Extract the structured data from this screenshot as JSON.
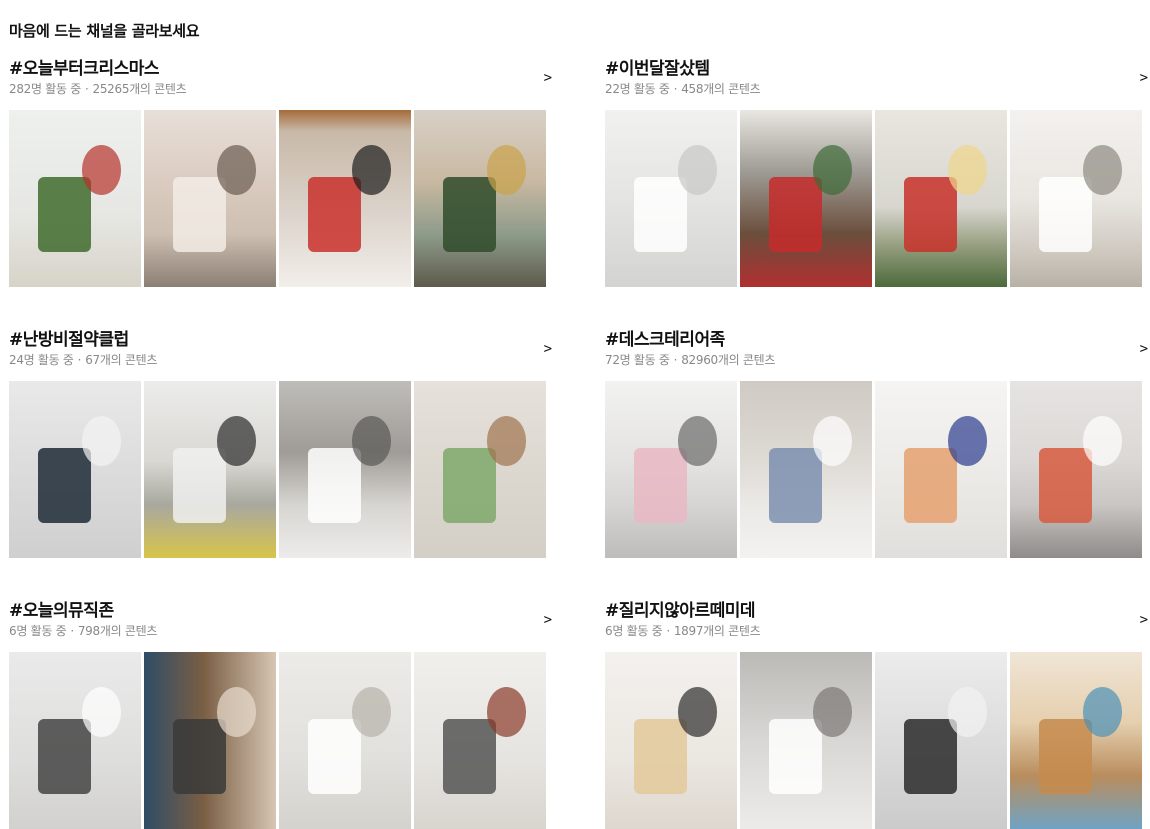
{
  "page": {
    "heading": "마음에 드는 채널을 골라보세요"
  },
  "channels": [
    {
      "name": "#오늘부터크리스마스",
      "members": "282명 활동 중",
      "sep": "·",
      "posts": "25265개의 콘텐츠",
      "more": ">",
      "thumbs": [
        {
          "bg": "linear-gradient(180deg,#eef0ee 0%,#e6e7e3 60%,#d7d3c8 100%)",
          "accent": "#3f6b2c",
          "accent2": "#b7322b"
        },
        {
          "bg": "linear-gradient(180deg,#e8dfd9 0%,#d9c9be 45%,#cdbfb1 70%,#8c7f74 100%)",
          "accent": "#f2ece5",
          "accent2": "#6b5b50"
        },
        {
          "bg": "linear-gradient(180deg,#a56b3a 0%,#c8b9a8 12%,#dcd4cc 60%,#f2eeea 100%)",
          "accent": "#c9302c",
          "accent2": "#1d1d1d"
        },
        {
          "bg": "linear-gradient(180deg,#d8d0c6 0%,#c9b9a2 40%,#8e9c8a 70%,#5e5a4c 100%)",
          "accent": "#2f4b2a",
          "accent2": "#c9a24a"
        }
      ]
    },
    {
      "name": "#이번달잘샀템",
      "members": "22명 활동 중",
      "sep": "·",
      "posts": "458개의 콘텐츠",
      "more": ">",
      "thumbs": [
        {
          "bg": "linear-gradient(180deg,#f1f1ef 0%,#e4e4e2 50%,#d3d3d1 100%)",
          "accent": "#ffffff",
          "accent2": "#c8c8c6"
        },
        {
          "bg": "linear-gradient(180deg,#e9e7e1 0%,#9e9b94 35%,#6b4e3c 70%,#b03030 100%)",
          "accent": "#c62b2b",
          "accent2": "#3d6b37"
        },
        {
          "bg": "linear-gradient(180deg,#e8e6df 0%,#d7d6cf 55%,#9ba285 75%,#4d6a3b 100%)",
          "accent": "#c8312a",
          "accent2": "#f0d58a"
        },
        {
          "bg": "linear-gradient(180deg,#f3f1ee 0%,#e9e6e1 50%,#cfc9c0 80%,#b8b1a6 100%)",
          "accent": "#ffffff",
          "accent2": "#8f8a82"
        }
      ]
    },
    {
      "name": "#난방비절약클럽",
      "members": "24명 활동 중",
      "sep": "·",
      "posts": "67개의 콘텐츠",
      "more": ">",
      "thumbs": [
        {
          "bg": "linear-gradient(180deg,#e9e9e9 0%,#dcdcdc 50%,#cfcfcf 100%)",
          "accent": "#1d2a36",
          "accent2": "#f4f4f4"
        },
        {
          "bg": "linear-gradient(180deg,#ececea 0%,#d9d8d3 45%,#a9a89f 70%,#d8c44a 100%)",
          "accent": "#f0f0ee",
          "accent2": "#2b2b2b"
        },
        {
          "bg": "linear-gradient(180deg,#bfbdb9 0%,#9f9c97 40%,#d7d5d1 70%,#eeecea 100%)",
          "accent": "#ffffff",
          "accent2": "#5a5855"
        },
        {
          "bg": "linear-gradient(180deg,#e6e2db 0%,#dcd7cf 50%,#d3cfc7 100%)",
          "accent": "#7fa86b",
          "accent2": "#a0734f"
        }
      ]
    },
    {
      "name": "#데스크테리어족",
      "members": "72명 활동 중",
      "sep": "·",
      "posts": "82960개의 콘텐츠",
      "more": ">",
      "thumbs": [
        {
          "bg": "linear-gradient(180deg,#f2f2f1 0%,#e4e3e1 45%,#d6d5d3 70%,#bdbcba 100%)",
          "accent": "#e9b9c3",
          "accent2": "#6b6b6b"
        },
        {
          "bg": "linear-gradient(180deg,#cfcac3 0%,#dcd8d2 40%,#ebe9e6 70%,#f3f2f0 100%)",
          "accent": "#7d8faf",
          "accent2": "#ffffff"
        },
        {
          "bg": "linear-gradient(180deg,#f5f4f2 0%,#ecebe8 50%,#e1dfdb 100%)",
          "accent": "#e5a16e",
          "accent2": "#2b3c8f"
        },
        {
          "bg": "linear-gradient(180deg,#e6e4e2 0%,#dbd8d5 45%,#c9c6c3 70%,#8e8b88 100%)",
          "accent": "#d75a3f",
          "accent2": "#ffffff"
        }
      ]
    },
    {
      "name": "#오늘의뮤직존",
      "members": "6명 활동 중",
      "sep": "·",
      "posts": "798개의 콘텐츠",
      "more": ">",
      "thumbs": [
        {
          "bg": "linear-gradient(180deg,#eaeaea 0%,#dededd 60%,#d2d1cf 100%)",
          "accent": "#444444",
          "accent2": "#ffffff"
        },
        {
          "bg": "linear-gradient(90deg,#2e4d66 0%,#7a5e44 45%,#d7c6b3 100%)",
          "accent": "#3a3a3a",
          "accent2": "#e8dccd"
        },
        {
          "bg": "linear-gradient(180deg,#ecebe8 0%,#e1e0dc 60%,#d4d2cd 100%)",
          "accent": "#ffffff",
          "accent2": "#b7b2aa"
        },
        {
          "bg": "linear-gradient(180deg,#f0efec 0%,#e6e4e0 60%,#d8d5cf 100%)",
          "accent": "#555555",
          "accent2": "#8a3b2a"
        }
      ]
    },
    {
      "name": "#질리지않아르떼미데",
      "members": "6명 활동 중",
      "sep": "·",
      "posts": "1897개의 콘텐츠",
      "more": ">",
      "thumbs": [
        {
          "bg": "linear-gradient(180deg,#f3f1ee 0%,#ebe7e1 60%,#ddd7ce 100%)",
          "accent": "#e3c99a",
          "accent2": "#2c2c2c"
        },
        {
          "bg": "linear-gradient(180deg,#bcbab7 0%,#d9d7d4 50%,#ecebe9 100%)",
          "accent": "#ffffff",
          "accent2": "#7a7875"
        },
        {
          "bg": "linear-gradient(180deg,#ececec 0%,#dcdcdc 50%,#cbcbcb 100%)",
          "accent": "#2a2a2a",
          "accent2": "#f2f2f2"
        },
        {
          "bg": "linear-gradient(180deg,#f0e5d6 0%,#e5cfae 40%,#b98d5d 70%,#6fa3c4 100%)",
          "accent": "#c58b4e",
          "accent2": "#4b91b8"
        }
      ]
    }
  ]
}
